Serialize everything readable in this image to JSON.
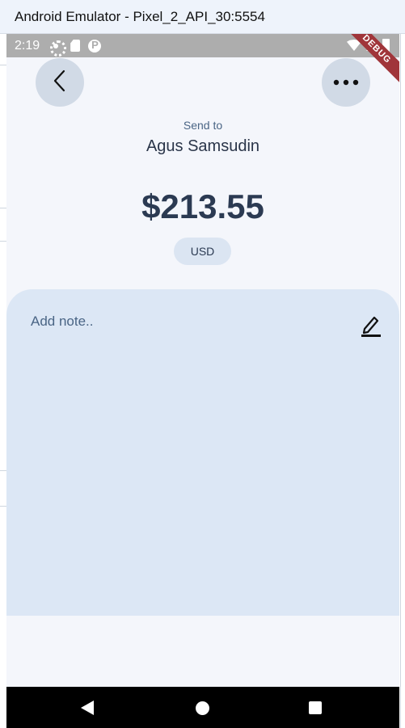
{
  "window": {
    "title": "Android Emulator - Pixel_2_API_30:5554"
  },
  "status_bar": {
    "time": "2:19",
    "left_icons": [
      "settings-icon",
      "sd-card-icon",
      "play-protect-icon"
    ],
    "right_icons": [
      "wifi-icon",
      "signal-icon",
      "battery-icon"
    ],
    "debug_banner": "DEBUG"
  },
  "header": {
    "back_icon": "chevron-left-icon",
    "more_icon": "more-horizontal-icon"
  },
  "transfer": {
    "send_to_label": "Send to",
    "recipient_name": "Agus Samsudin",
    "amount": "$213.55",
    "currency": "USD"
  },
  "note": {
    "placeholder": "Add note..",
    "edit_icon": "edit-pencil-icon"
  },
  "nav_bar": {
    "icons": [
      "back-triangle-icon",
      "home-circle-icon",
      "recents-square-icon"
    ]
  },
  "colors": {
    "background": "#f4f6fb",
    "card": "#dce7f5",
    "button": "#d1dae6",
    "text_primary": "#2b3a52",
    "text_secondary": "#4a6585",
    "debug_ribbon": "#a0353a"
  }
}
